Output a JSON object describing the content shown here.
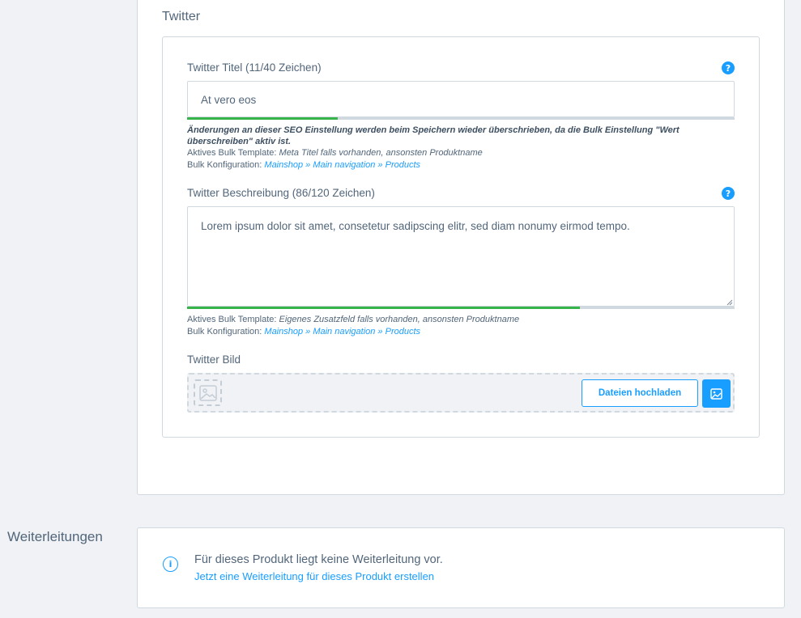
{
  "twitter_section": {
    "title": "Twitter",
    "title_field": {
      "label": "Twitter Titel (11/40 Zeichen)",
      "value": "At vero eos",
      "progress_fraction": 0.275,
      "warning": "Änderungen an dieser SEO Einstellung werden beim Speichern wieder überschrieben, da die Bulk Einstellung \"Wert überschreiben\" aktiv ist.",
      "template_label": "Aktives Bulk Template:",
      "template_value": "Meta Titel falls vorhanden, ansonsten Produktname",
      "config_label": "Bulk Konfiguration:",
      "config_link": "Mainshop » Main navigation » Products"
    },
    "description_field": {
      "label": "Twitter Beschreibung (86/120 Zeichen)",
      "value": "Lorem ipsum dolor sit amet, consetetur sadipscing elitr, sed diam nonumy eirmod tempo.",
      "progress_fraction": 0.717,
      "template_label": "Aktives Bulk Template:",
      "template_value": "Eigenes Zusatzfeld falls vorhanden, ansonsten Produktname",
      "config_label": "Bulk Konfiguration:",
      "config_link": "Mainshop » Main navigation » Products"
    },
    "image_field": {
      "label": "Twitter Bild",
      "upload_button": "Dateien hochladen"
    },
    "help_icon_glyph": "?"
  },
  "redirects": {
    "heading": "Weiterleitungen",
    "info_text": "Für dieses Produkt liegt keine Weiterleitung vor.",
    "create_link": "Jetzt eine Weiterleitung für dieses Produkt erstellen",
    "info_icon_glyph": "i"
  },
  "colors": {
    "accent": "#189eff",
    "progress": "#37b44a",
    "text": "#52667a",
    "border": "#d1d9e0"
  }
}
